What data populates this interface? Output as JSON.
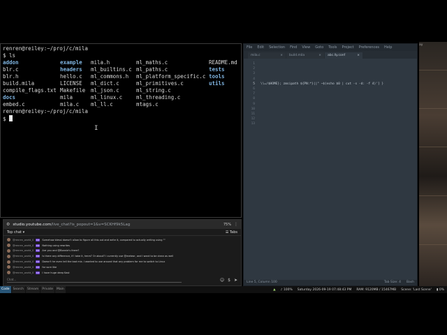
{
  "terminal": {
    "title_prompt": "renren@reiley:~/proj/c/mila",
    "command": "$ ls",
    "ls_rows": [
      [
        {
          "t": "addon",
          "d": true
        },
        {
          "t": "example",
          "d": true
        },
        {
          "t": "mila.h",
          "d": false
        },
        {
          "t": "ml_maths.c",
          "d": false
        },
        {
          "t": "README.md",
          "d": false
        }
      ],
      [
        {
          "t": "blr.c",
          "d": false
        },
        {
          "t": "headers",
          "d": true
        },
        {
          "t": "ml_builtins.c",
          "d": false
        },
        {
          "t": "ml_paths.c",
          "d": false
        },
        {
          "t": "tests",
          "d": true
        }
      ],
      [
        {
          "t": "blr.h",
          "d": false
        },
        {
          "t": "hello.c",
          "d": false
        },
        {
          "t": "ml_commons.h",
          "d": false
        },
        {
          "t": "ml_platform_specific.c",
          "d": false
        },
        {
          "t": "tools",
          "d": true
        }
      ],
      [
        {
          "t": "build.mila",
          "d": false
        },
        {
          "t": "LICENSE",
          "d": false
        },
        {
          "t": "ml_dict.c",
          "d": false
        },
        {
          "t": "ml_primitives.c",
          "d": false
        },
        {
          "t": "utils",
          "d": true
        }
      ],
      [
        {
          "t": "compile_flags.txt",
          "d": false
        },
        {
          "t": "Makefile",
          "d": false
        },
        {
          "t": "ml_json.c",
          "d": false
        },
        {
          "t": "ml_string.c",
          "d": false
        },
        {
          "t": "",
          "d": false
        }
      ],
      [
        {
          "t": "docs",
          "d": true
        },
        {
          "t": "mila",
          "d": false
        },
        {
          "t": "ml_linux.c",
          "d": false
        },
        {
          "t": "ml_threading.c",
          "d": false
        },
        {
          "t": "",
          "d": false
        }
      ],
      [
        {
          "t": "embed.c",
          "d": false
        },
        {
          "t": "mila.c",
          "d": false
        },
        {
          "t": "ml_ll.c",
          "d": false
        },
        {
          "t": "mtags.c",
          "d": false
        },
        {
          "t": "",
          "d": false
        }
      ]
    ],
    "prompt2": "renren@reiley:~/proj/c/mila",
    "prompt3": "$ "
  },
  "editor": {
    "menu": [
      "File",
      "Edit",
      "Selection",
      "Find",
      "View",
      "Goto",
      "Tools",
      "Project",
      "Preferences",
      "Help"
    ],
    "tabs": [
      {
        "label": "mila.c",
        "active": false
      },
      {
        "label": "build.mila",
        "active": false
      },
      {
        "label": "abc.lly.conf",
        "active": true
      }
    ],
    "line_numbers": [
      "1",
      "2",
      "3",
      "4",
      "5",
      "6",
      "7",
      "8",
      "9",
      "10",
      "11",
      "12",
      "13"
    ],
    "current_line": 5,
    "code_line_5": "\\\\=/$HOME}; zmsipath ${PN:*}||\" ~$(echo $0 | cut -s -d: -f 4)'] }",
    "status_left": "Line 5, Column 100",
    "status_right_1": "Tab Size: 4",
    "status_right_2": "Bash"
  },
  "mini_pane": "ay",
  "browser": {
    "url_host": "studio.youtube.com",
    "url_path": "/live_chat?is_popout=1&v=SCKHf9k5Lag",
    "zoom": "75%",
    "chat_title": "Top chat",
    "chat_menu": "Tabs",
    "messages": [
      {
        "user": "@renren_world_001",
        "msg": "Somehow blessi doesn't allow to figure all this out and write it, compared to actually writing using \"\""
      },
      {
        "user": "@renren_world_001",
        "msg": "Nothing using rewrites"
      },
      {
        "user": "@renren_world_001",
        "msg": "Are you and @Bonnie's there?"
      },
      {
        "user": "@renren_world_001",
        "msg": "Is there any difference, if I take it, hmm? Or about? I currently use @meteor, and I want to be clean as well"
      },
      {
        "user": "@renren_world_001",
        "msg": "Doesn't he even tell the bad mix. I wanted to use around that any problem for me to switch to Linux"
      },
      {
        "user": "@renren_world_001",
        "msg": "for sure like"
      },
      {
        "user": "@renren_world_001",
        "msg": "I have huge deep Kast"
      }
    ],
    "badge": "MT",
    "chat_placeholder": "Chat..."
  },
  "statusbar": {
    "workspaces": [
      {
        "label": "Code",
        "active": true
      },
      {
        "label": "Search",
        "active": false
      },
      {
        "label": "Stream",
        "active": false
      },
      {
        "label": "Private",
        "active": false
      },
      {
        "label": "Main",
        "active": false
      }
    ],
    "volume": "100%",
    "datetime": "Saturday 2026-09-19 07:48:43 PM",
    "ram": "RAM: 9120MB / 15467MB",
    "scene": "Scene: 'Last Scene'",
    "battery": "0%"
  }
}
